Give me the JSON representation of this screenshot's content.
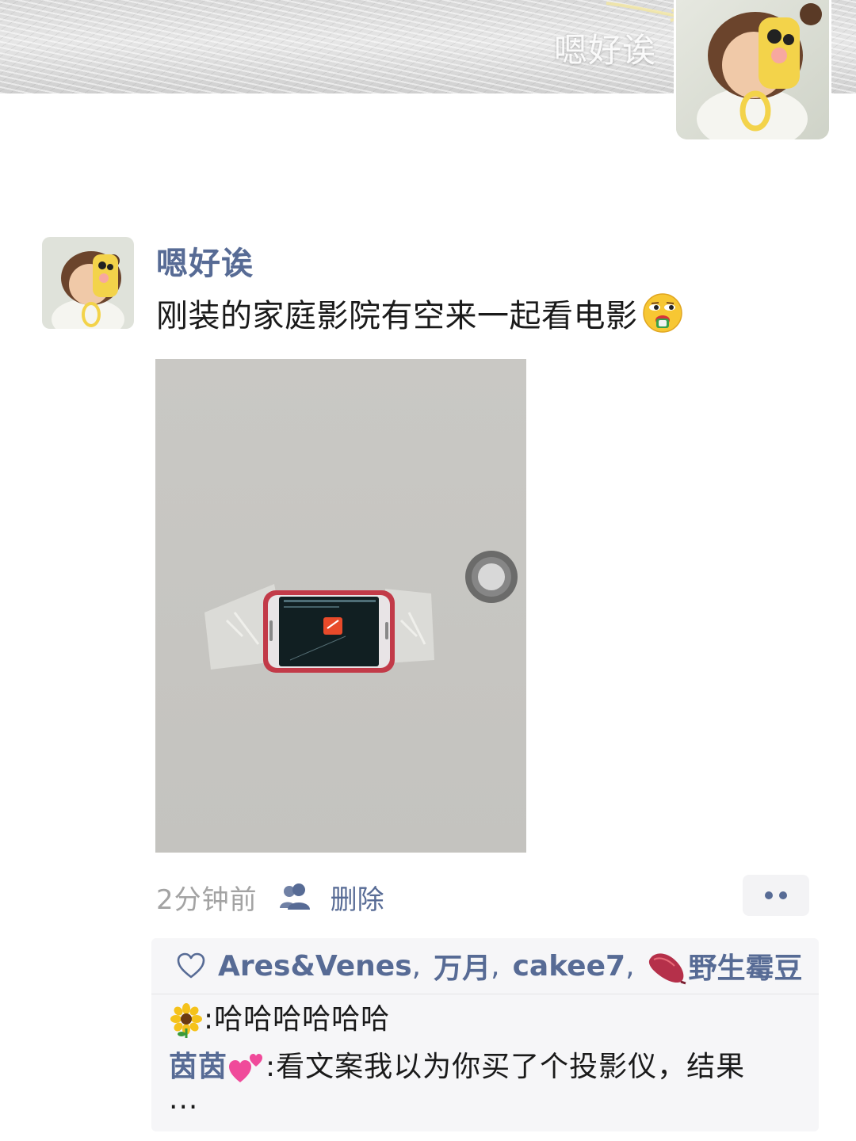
{
  "cover": {
    "name": "嗯好诶"
  },
  "post": {
    "author": "嗯好诶",
    "text": "刚装的家庭影院有空来一起看电影",
    "emoji": "face-with-money-icon"
  },
  "meta": {
    "time": "2分钟前",
    "delete_label": "删除"
  },
  "likes": {
    "names": [
      "Ares&Venes",
      "万月",
      "cakee7",
      "野生霉豆"
    ],
    "separator": ","
  },
  "comments": [
    {
      "author_icon": "sunflower-icon",
      "author": "",
      "colon": ":",
      "text": "哈哈哈哈哈哈"
    },
    {
      "author": "茵茵",
      "author_icon": "two-hearts-icon",
      "colon": ":",
      "text": "看文案我以为你买了个投影仪，结果",
      "more": "..."
    }
  ],
  "colors": {
    "link": "#576b95",
    "meta_gray": "#a3a3a3",
    "panel_bg": "#f6f6f8"
  }
}
